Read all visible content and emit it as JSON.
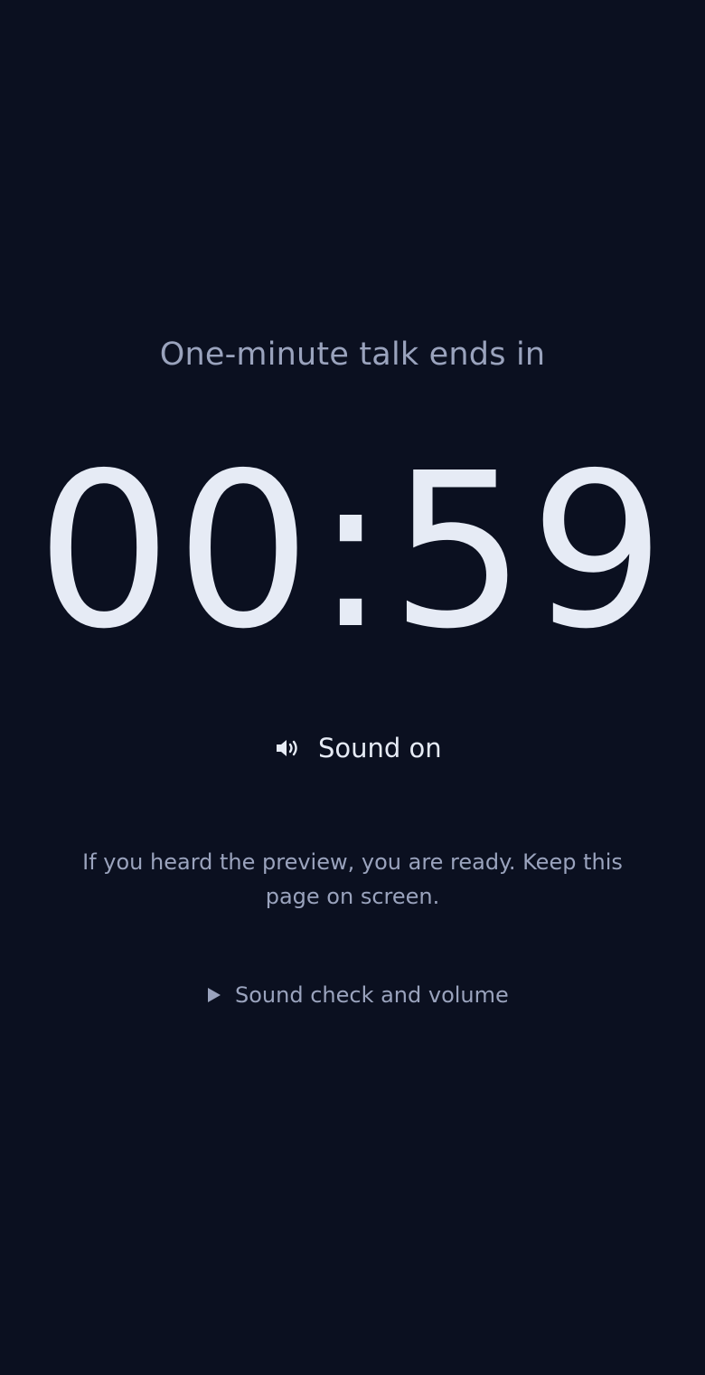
{
  "timer": {
    "heading": "One-minute talk ends in",
    "display": "00:59"
  },
  "sound": {
    "icon": "speaker-icon",
    "label": "Sound on"
  },
  "status": {
    "message": "If you heard the preview, you are ready. Keep this page on screen."
  },
  "sound_check": {
    "icon": "disclosure-triangle-icon",
    "label": "Sound check and volume",
    "expanded": false
  },
  "colors": {
    "background": "#0b1020",
    "primary_text": "#e6ebf5",
    "muted_text": "#9aa3bd"
  }
}
